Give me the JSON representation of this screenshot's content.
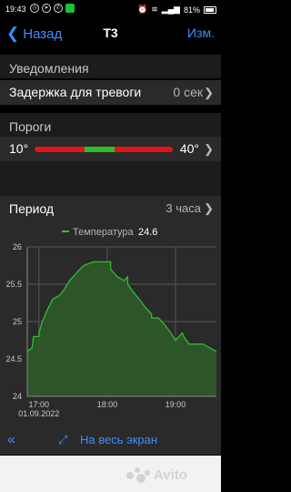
{
  "status": {
    "time": "19:43",
    "battery": "81%"
  },
  "nav": {
    "back_label": "Назад",
    "title": "T3",
    "edit_label": "Изм."
  },
  "notifications": {
    "header": "Уведомления",
    "alarm_delay": {
      "label": "Задержка для тревоги",
      "value": "0 сек"
    }
  },
  "thresholds": {
    "header": "Пороги",
    "min": "10°",
    "max": "40°"
  },
  "period": {
    "label": "Период",
    "value": "3 часа"
  },
  "chart_data": {
    "type": "line",
    "legend": [
      {
        "name": "Температура",
        "value": "24.6",
        "color": "#2dbf2a"
      }
    ],
    "y_ticks": [
      "26",
      "25.5",
      "25",
      "24.5",
      "24"
    ],
    "x_ticks": [
      "17:00",
      "18:00",
      "19:00"
    ],
    "x_sublabel": "01.09.2022",
    "ylim": [
      24,
      26
    ],
    "xlim": [
      16.83,
      19.6
    ],
    "x": [
      16.83,
      16.9,
      16.92,
      17.0,
      17.0,
      17.05,
      17.12,
      17.2,
      17.3,
      17.35,
      17.45,
      17.55,
      17.65,
      17.8,
      17.95,
      18.05,
      18.05,
      18.15,
      18.25,
      18.3,
      18.3,
      18.38,
      18.47,
      18.55,
      18.65,
      18.65,
      18.75,
      18.85,
      18.93,
      19.0,
      19.05,
      19.1,
      19.12,
      19.2,
      19.32,
      19.4,
      19.5,
      19.6
    ],
    "y": [
      24.6,
      24.65,
      24.8,
      24.8,
      24.85,
      25.0,
      25.15,
      25.3,
      25.35,
      25.4,
      25.55,
      25.65,
      25.75,
      25.8,
      25.8,
      25.8,
      25.7,
      25.6,
      25.55,
      25.6,
      25.5,
      25.4,
      25.3,
      25.2,
      25.1,
      25.05,
      25.05,
      24.95,
      24.85,
      24.75,
      24.8,
      24.85,
      24.8,
      24.7,
      24.7,
      24.7,
      24.65,
      24.6
    ],
    "line_color": "#2dbf2a",
    "fill_color": "#2f5a2a",
    "grid": true
  },
  "bottom": {
    "fullscreen_label": "На весь экран"
  },
  "colors": {
    "accent": "#3c8cff",
    "alarm_red": "#e0161b",
    "ok_green": "#2dbf2a"
  }
}
